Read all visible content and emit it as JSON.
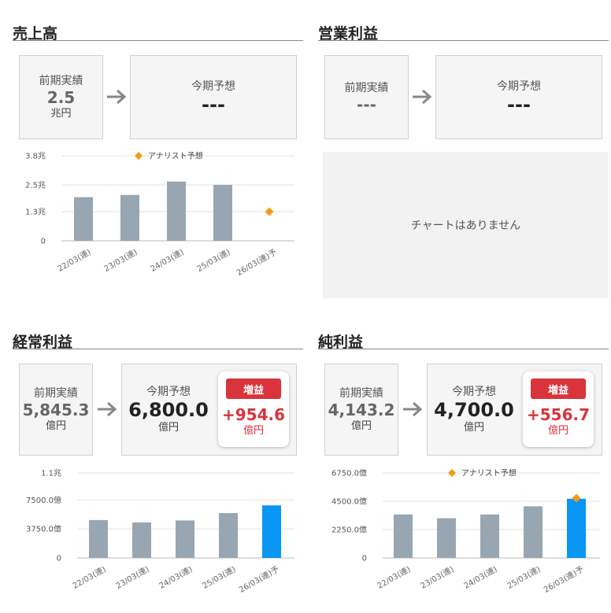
{
  "colors": {
    "actual_bar": "#98a6b2",
    "forecast_bar": "#0a96f5",
    "analyst_marker": "#f29a16",
    "up_badge": "#d9343b"
  },
  "icons": {
    "arrow": "arrow-right-icon",
    "legend": "diamond-marker-icon"
  },
  "sections": {
    "sales": {
      "title": "売上高",
      "prev_label": "前期実績",
      "prev_value": "2.5",
      "prev_unit": "兆円",
      "cur_label": "今期予想",
      "cur_value": "---"
    },
    "operating": {
      "title": "営業利益",
      "prev_label": "前期実績",
      "prev_value": "---",
      "cur_label": "今期予想",
      "cur_value": "---",
      "no_chart": "チャートはありません"
    },
    "ordinary": {
      "title": "経常利益",
      "prev_label": "前期実績",
      "prev_value": "5,845.3",
      "prev_unit": "億円",
      "cur_label": "今期予想",
      "cur_value": "6,800.0",
      "cur_unit": "億円",
      "badge": "増益",
      "diff": "+954.6",
      "diff_unit": "億円"
    },
    "net": {
      "title": "純利益",
      "prev_label": "前期実績",
      "prev_value": "4,143.2",
      "prev_unit": "億円",
      "cur_label": "今期予想",
      "cur_value": "4,700.0",
      "cur_unit": "億円",
      "badge": "増益",
      "diff": "+556.7",
      "diff_unit": "億円"
    }
  },
  "chart_data": [
    {
      "type": "bar",
      "categories": [
        "22/03(連)",
        "23/03(連)",
        "24/03(連)",
        "25/03(連)",
        "26/03(連)予"
      ],
      "values": [
        1.95,
        2.05,
        2.65,
        2.5,
        null
      ],
      "analyst": [
        null,
        null,
        null,
        null,
        1.3
      ],
      "legend": "アナリスト予想",
      "legend_position": "top-center",
      "yticks": [
        0,
        1.3,
        2.5,
        3.8
      ],
      "ytick_labels": [
        "0",
        "1.3兆",
        "2.5兆",
        "3.8兆"
      ],
      "ylim": [
        0,
        3.8
      ],
      "grid": true
    },
    {
      "type": "bar",
      "categories": [
        "22/03(連)",
        "23/03(連)",
        "24/03(連)",
        "25/03(連)",
        "26/03(連)予"
      ],
      "values": [
        4900,
        4600,
        4850,
        5800,
        6800
      ],
      "forecast_index": 4,
      "yticks": [
        0,
        3750,
        7500,
        11000
      ],
      "ytick_labels": [
        "0",
        "3750.0億",
        "7500.0億",
        "1.1兆"
      ],
      "ylim": [
        0,
        11000
      ],
      "grid": true
    },
    {
      "type": "bar",
      "categories": [
        "22/03(連)",
        "23/03(連)",
        "24/03(連)",
        "25/03(連)",
        "26/03(連)予"
      ],
      "values": [
        3450,
        3150,
        3450,
        4100,
        4700
      ],
      "forecast_index": 4,
      "analyst": [
        null,
        null,
        null,
        null,
        4750
      ],
      "legend": "アナリスト予想",
      "legend_position": "top-center",
      "yticks": [
        0,
        2250,
        4500,
        6750
      ],
      "ytick_labels": [
        "0",
        "2250.0億",
        "4500.0億",
        "6750.0億"
      ],
      "ylim": [
        0,
        6750
      ],
      "grid": true
    }
  ]
}
